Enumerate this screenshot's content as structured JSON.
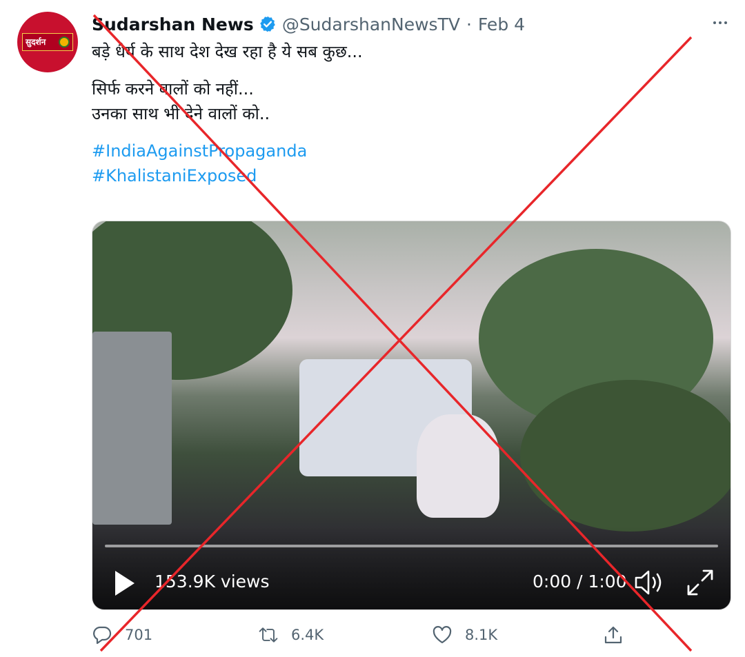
{
  "tweet": {
    "author_name": "Sudarshan News",
    "handle": "@SudarshanNewsTV",
    "separator": "·",
    "date": "Feb 4",
    "avatar_text": "सुदर्शन",
    "lines": [
      "बड़े धैर्य के साथ देश देख रहा है ये सब कुछ...",
      "सिर्फ करने वालों को नहीं...",
      "उनका साथ भी देने वालों को.."
    ],
    "hashtags": [
      "#IndiaAgainstPropaganda",
      "#KhalistaniExposed"
    ]
  },
  "video": {
    "views": "153.9K views",
    "time": "0:00 / 1:00",
    "progress": 0
  },
  "actions": {
    "replies": "701",
    "retweets": "6.4K",
    "likes": "8.1K"
  },
  "icons": {
    "verified": "verified-badge-icon",
    "more": "more-options-icon",
    "play": "play-icon",
    "volume": "volume-icon",
    "fullscreen": "fullscreen-icon",
    "reply": "reply-icon",
    "retweet": "retweet-icon",
    "like": "like-icon",
    "share": "share-icon"
  },
  "colors": {
    "link": "#1d9bf0",
    "muted": "#536471",
    "overlay_cross": "#e8262a",
    "brand": "#c8102e"
  }
}
